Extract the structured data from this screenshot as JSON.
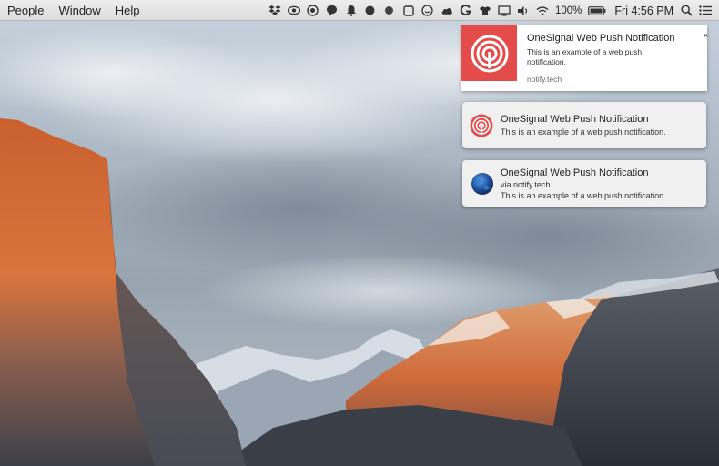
{
  "menubar": {
    "menus": [
      "People",
      "Window",
      "Help"
    ],
    "battery_percent": "100%",
    "clock": "Fri 4:56 PM",
    "tray_icons": [
      "dropbox-icon",
      "eye-icon",
      "record-icon",
      "chat-bubble-icon",
      "bell-icon",
      "circle-icon",
      "dot-icon",
      "square-icon",
      "smiley-icon",
      "cloud-icon",
      "g-icon",
      "tshirt-icon",
      "airplay-icon",
      "volume-icon",
      "wifi-icon",
      "battery-icon",
      "search-icon",
      "list-icon"
    ]
  },
  "notifications": {
    "large": {
      "title": "OneSignal Web Push Notification",
      "body": "This is an example of a web push notification.",
      "origin": "notify.tech",
      "close_label": "×",
      "hero_color": "#e44b4b"
    },
    "chrome": {
      "title": "OneSignal Web Push Notification",
      "body": "This is an example of a web push notification."
    },
    "firefox": {
      "title": "OneSignal Web Push Notification",
      "via": "via notify.tech",
      "body": "This is an example of a web push notification."
    }
  },
  "colors": {
    "accent_red": "#e44b4b",
    "menubar_bg": "#e6e6e6"
  }
}
